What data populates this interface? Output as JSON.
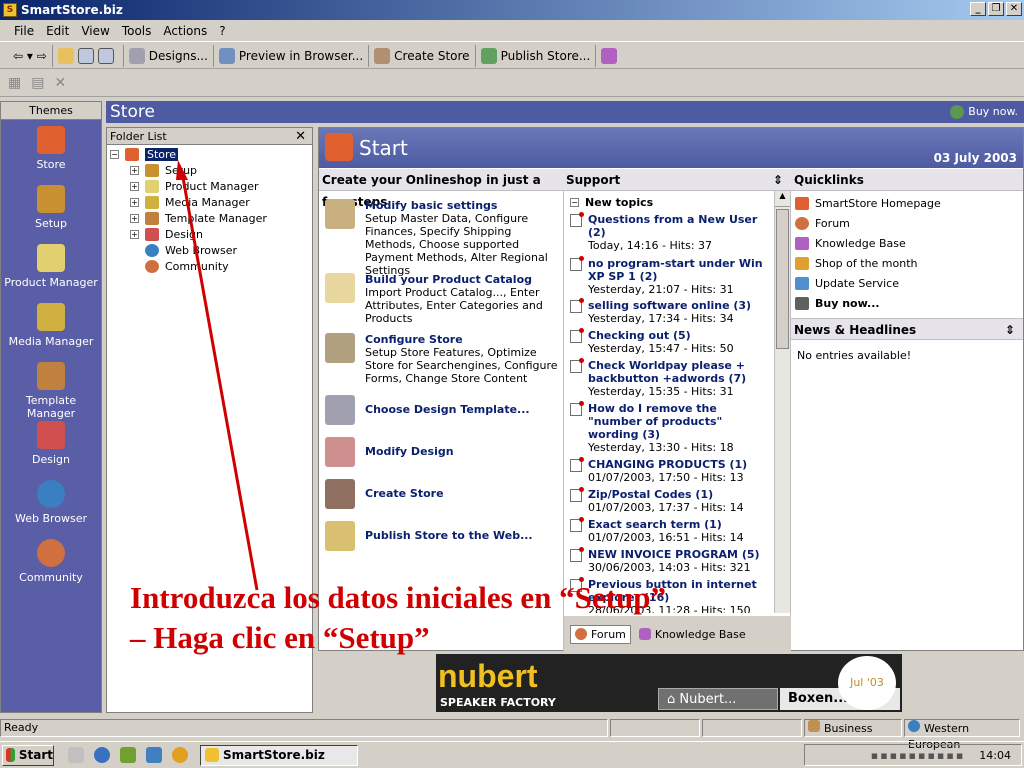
{
  "window": {
    "title": "SmartStore.biz",
    "min": "_",
    "max": "❐",
    "close": "✕"
  },
  "menu": [
    "File",
    "Edit",
    "View",
    "Tools",
    "Actions",
    "?"
  ],
  "toolbar": {
    "designs": "Designs...",
    "preview": "Preview in Browser...",
    "create": "Create Store",
    "publish": "Publish Store..."
  },
  "themes": {
    "header": "Themes",
    "items": [
      "Store",
      "Setup",
      "Product Manager",
      "Media Manager",
      "Template Manager",
      "Design",
      "Web Browser",
      "Community"
    ],
    "colors": [
      "#e06030",
      "#c89030",
      "#e0d070",
      "#d0b040",
      "#c08040",
      "#d05050",
      "#3a80c0",
      "#d07040"
    ]
  },
  "storebar": {
    "title": "Store",
    "buynow": "Buy now."
  },
  "folder": {
    "title": "Folder List",
    "close": "✕",
    "root": "Store",
    "children": [
      "Setup",
      "Product Manager",
      "Media Manager",
      "Template Manager",
      "Design",
      "Web Browser",
      "Community"
    ]
  },
  "start": {
    "title": "Start",
    "date": "03 July 2003",
    "steps_header": "Create your Onlineshop in just a few steps",
    "steps": [
      {
        "title": "Modify basic settings",
        "desc": "Setup Master Data, Configure Finances, Specify Shipping Methods, Choose supported Payment Methods, Alter Regional Settings"
      },
      {
        "title": "Build your Product Catalog",
        "desc": "Import Product Catalog..., Enter Attributes, Enter Categories and Products"
      },
      {
        "title": "Configure Store",
        "desc": "Setup Store Features, Optimize Store for Searchengines, Configure Forms, Change Store Content"
      },
      {
        "title": "Choose Design Template...",
        "desc": ""
      },
      {
        "title": "Modify Design",
        "desc": ""
      },
      {
        "title": "Create Store",
        "desc": ""
      },
      {
        "title": "Publish Store to the Web...",
        "desc": ""
      }
    ]
  },
  "support": {
    "header": "Support",
    "group": "New topics",
    "topics": [
      {
        "title": "Questions from a New User (2)",
        "meta": "Today, 14:16 - Hits: 37"
      },
      {
        "title": "no program-start under Win XP SP 1 (2)",
        "meta": "Yesterday, 21:07 - Hits: 31"
      },
      {
        "title": "selling software online (3)",
        "meta": "Yesterday, 17:34 - Hits: 34"
      },
      {
        "title": "Checking out (5)",
        "meta": "Yesterday, 15:47 - Hits: 50"
      },
      {
        "title": "Check Worldpay please + backbutton +adwords (7)",
        "meta": "Yesterday, 15:35 - Hits: 31"
      },
      {
        "title": "How do I remove the \"number of products\" wording (3)",
        "meta": "Yesterday, 13:30 - Hits: 18"
      },
      {
        "title": "CHANGING PRODUCTS (1)",
        "meta": "01/07/2003, 17:50 - Hits: 13"
      },
      {
        "title": "Zip/Postal Codes (1)",
        "meta": "01/07/2003, 17:37 - Hits: 14"
      },
      {
        "title": "Exact search term (1)",
        "meta": "01/07/2003, 16:51 - Hits: 14"
      },
      {
        "title": "NEW INVOICE PROGRAM (5)",
        "meta": "30/06/2003, 14:03 - Hits: 321"
      },
      {
        "title": "Previous button in internet explorer (16)",
        "meta": "28/06/2003, 11:28 - Hits: 150"
      }
    ],
    "tabs": [
      "Forum",
      "Knowledge Base"
    ]
  },
  "quicklinks": {
    "header": "Quicklinks",
    "items": [
      "SmartStore Homepage",
      "Forum",
      "Knowledge Base",
      "Shop of the month",
      "Update Service",
      "Buy now..."
    ],
    "news_header": "News & Headlines",
    "news_empty": "No entries available!"
  },
  "banner": {
    "brand": "nubert",
    "sub": "SPEAKER FACTORY",
    "tab1": "Nubert...",
    "tab2": "Boxen...",
    "badge": "Jul '03"
  },
  "overlay": {
    "line1": "Introduzca los datos iniciales en “Setup”",
    "line2": "– Haga clic en “Setup”"
  },
  "status": {
    "ready": "Ready",
    "business": "Business",
    "locale": "Western European"
  },
  "taskbar": {
    "start": "Start",
    "task": "SmartStore.biz",
    "clock": "14:04"
  },
  "accent": "#4e5aa2",
  "overlay_color": "#d00000"
}
